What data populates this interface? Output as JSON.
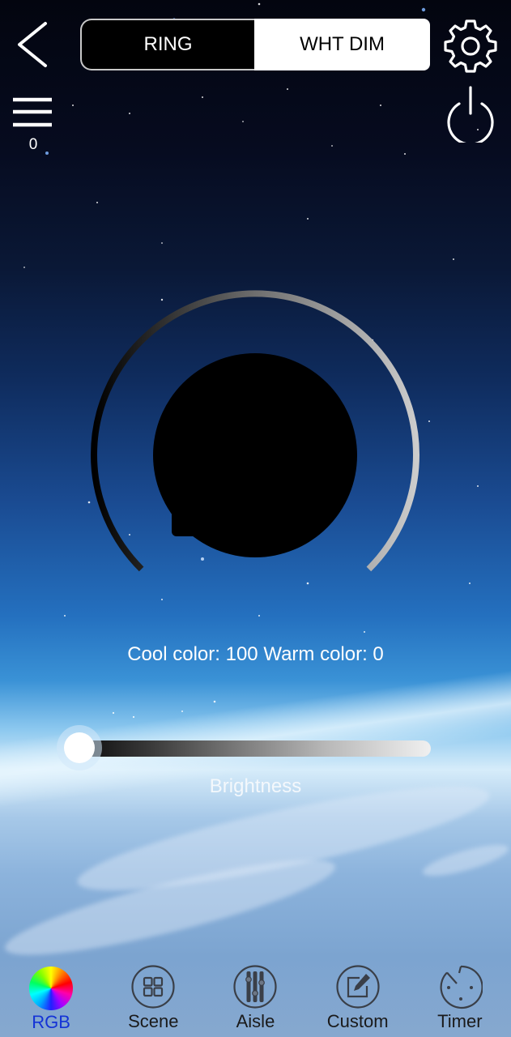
{
  "header": {
    "back_icon": "chevron-left-icon",
    "segments": [
      {
        "label": "RING",
        "selected": false
      },
      {
        "label": "WHT DIM",
        "selected": true
      }
    ],
    "settings_icon": "gear-icon",
    "menu_icon": "hamburger-menu-icon",
    "menu_count": "0",
    "power_icon": "power-icon"
  },
  "dial": {
    "cool_value": 100,
    "warm_value": 0,
    "gradient_start_color": "#000000",
    "gradient_end_color": "#cccccc"
  },
  "status": {
    "color_text": "Cool color: 100 Warm color: 0"
  },
  "brightness": {
    "label": "Brightness",
    "value_fraction": 0.0
  },
  "tabbar": {
    "active_color": "#1433d6",
    "tabs": [
      {
        "label": "RGB",
        "icon": "color-wheel-icon",
        "active": true
      },
      {
        "label": "Scene",
        "icon": "grid-icon",
        "active": false
      },
      {
        "label": "Aisle",
        "icon": "equalizer-icon",
        "active": false
      },
      {
        "label": "Custom",
        "icon": "edit-icon",
        "active": false
      },
      {
        "label": "Timer",
        "icon": "timer-icon",
        "active": false
      }
    ]
  }
}
